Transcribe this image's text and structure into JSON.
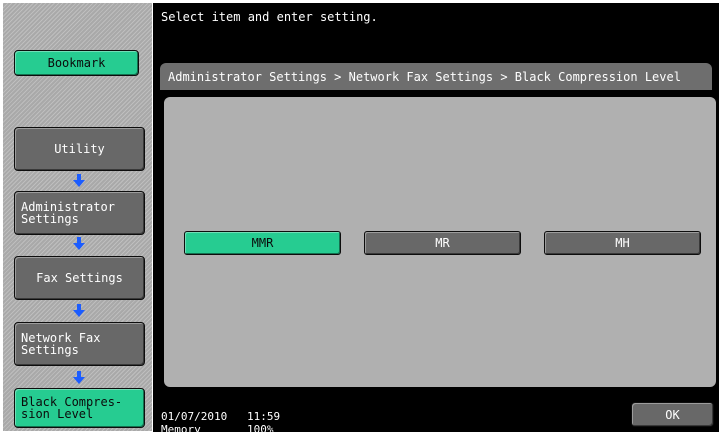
{
  "colors": {
    "green": "#26cc91",
    "gray_button": "#686868",
    "panel_gray": "#b0b0b0",
    "black": "#000000"
  },
  "header": {
    "message": "Select item and enter setting."
  },
  "sidebar": {
    "bookmark_label": "Bookmark",
    "items": [
      {
        "label": "Utility"
      },
      {
        "label_line1": "Administrator",
        "label_line2": "Settings"
      },
      {
        "label": "Fax Settings"
      },
      {
        "label_line1": "Network Fax",
        "label_line2": "Settings"
      },
      {
        "label_line1": "Black Compres-",
        "label_line2": "sion Level"
      }
    ],
    "arrow_icon": "down-arrow-icon"
  },
  "breadcrumb": {
    "text": "Administrator Settings > Network Fax Settings > Black Compression Level"
  },
  "options": [
    {
      "label": "MMR",
      "selected": true
    },
    {
      "label": "MR",
      "selected": false
    },
    {
      "label": "MH",
      "selected": false
    }
  ],
  "footer": {
    "date": "01/07/2010",
    "time": "11:59",
    "memory_label": "Memory",
    "memory_value": "100%",
    "ok_label": "OK"
  }
}
